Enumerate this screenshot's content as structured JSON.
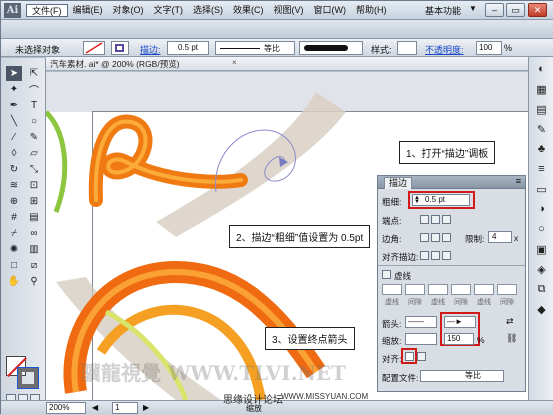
{
  "app": {
    "logo_text": "Ai",
    "menu": [
      "文件(F)",
      "编辑(E)",
      "对象(O)",
      "文字(T)",
      "选择(S)",
      "效果(C)",
      "视图(V)",
      "窗口(W)",
      "帮助(H)"
    ],
    "workspace_label": "基本功能",
    "workspace_arrow": "▼"
  },
  "control_bar": {
    "selection_label": "未选择对象",
    "stroke_label": "描边:",
    "stroke_weight": "0.5 pt",
    "profile_label": "等比",
    "style_label": "样式:",
    "opacity_label": "不透明度:",
    "opacity_value": "100",
    "opacity_unit": "%"
  },
  "document": {
    "tab_label": "汽车素材. ai* @ 200% (RGB/预览)",
    "close_glyph": "×"
  },
  "stroke_panel": {
    "title": "描边",
    "weight_label": "粗细:",
    "weight_value": "0.5 pt",
    "cap_label": "端点:",
    "join_label": "边角:",
    "limit_label": "限制:",
    "limit_value": "4",
    "limit_unit": "x",
    "align_label": "对齐描边:",
    "dashed_label": "虚线",
    "dash_headers": [
      "虚线",
      "间隙",
      "虚线",
      "间隙",
      "虚线",
      "间隙"
    ],
    "arrow_label": "箭头:",
    "scale_label": "缩放:",
    "scale_value": "150",
    "scale_unit": "%",
    "align_arrow_label": "对齐:",
    "profile_label": "配置文件:",
    "profile_value": "等比"
  },
  "callouts": {
    "step1": "1、打开“描边”调板",
    "step2": "2、描边“粗细”值设置为 0.5pt",
    "step3": "3、设置终点箭头"
  },
  "watermark": {
    "line1": "骥龍視覺 WWW.TLVI.NET",
    "line2": "思缘设计论坛",
    "line3": "WWW.MISSYUAN.COM"
  },
  "status_bar": {
    "zoom": "200%",
    "page": "1",
    "status_label": "缩放"
  },
  "colors": {
    "accent_red": "#d11a1a",
    "orange_art": "#f07a12",
    "link_blue": "#1848c8"
  }
}
